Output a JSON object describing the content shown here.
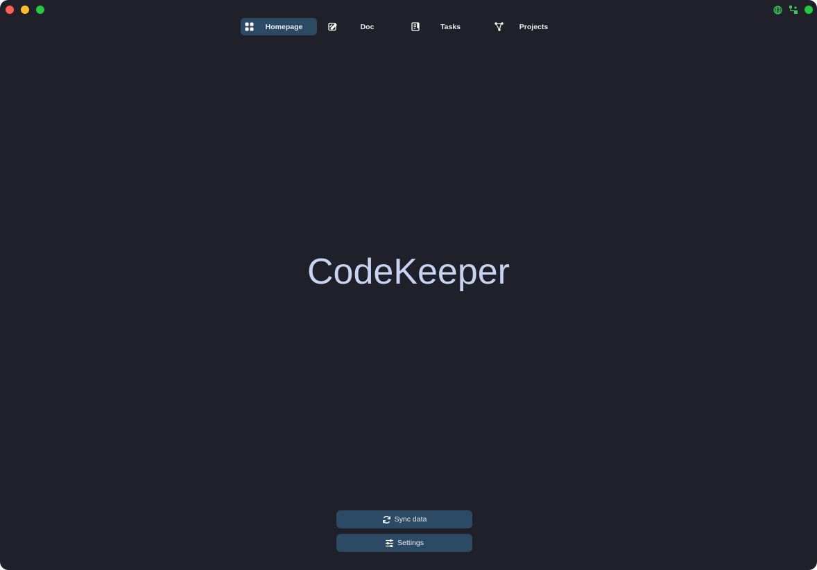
{
  "window": {
    "traffic_lights": {
      "close_color": "#ff5f57",
      "minimize_color": "#febc2e",
      "maximize_color": "#28c840"
    }
  },
  "status": {
    "icons": [
      "globe-icon",
      "network-icon"
    ],
    "icon_color": "#3ec85a",
    "connection_dot_color": "#28c840"
  },
  "nav": {
    "items": [
      {
        "label": "Homepage",
        "icon": "grid-icon",
        "active": true
      },
      {
        "label": "Doc",
        "icon": "edit-doc-icon",
        "active": false
      },
      {
        "label": "Tasks",
        "icon": "tasks-icon",
        "active": false
      },
      {
        "label": "Projects",
        "icon": "graph-icon",
        "active": false
      }
    ]
  },
  "main": {
    "title": "CodeKeeper"
  },
  "actions": {
    "sync_label": "Sync data",
    "sync_icon": "refresh-icon",
    "settings_label": "Settings",
    "settings_icon": "sliders-icon"
  },
  "colors": {
    "background": "#1f2029",
    "accent": "#2c4a63",
    "title": "#c6d4f2"
  }
}
